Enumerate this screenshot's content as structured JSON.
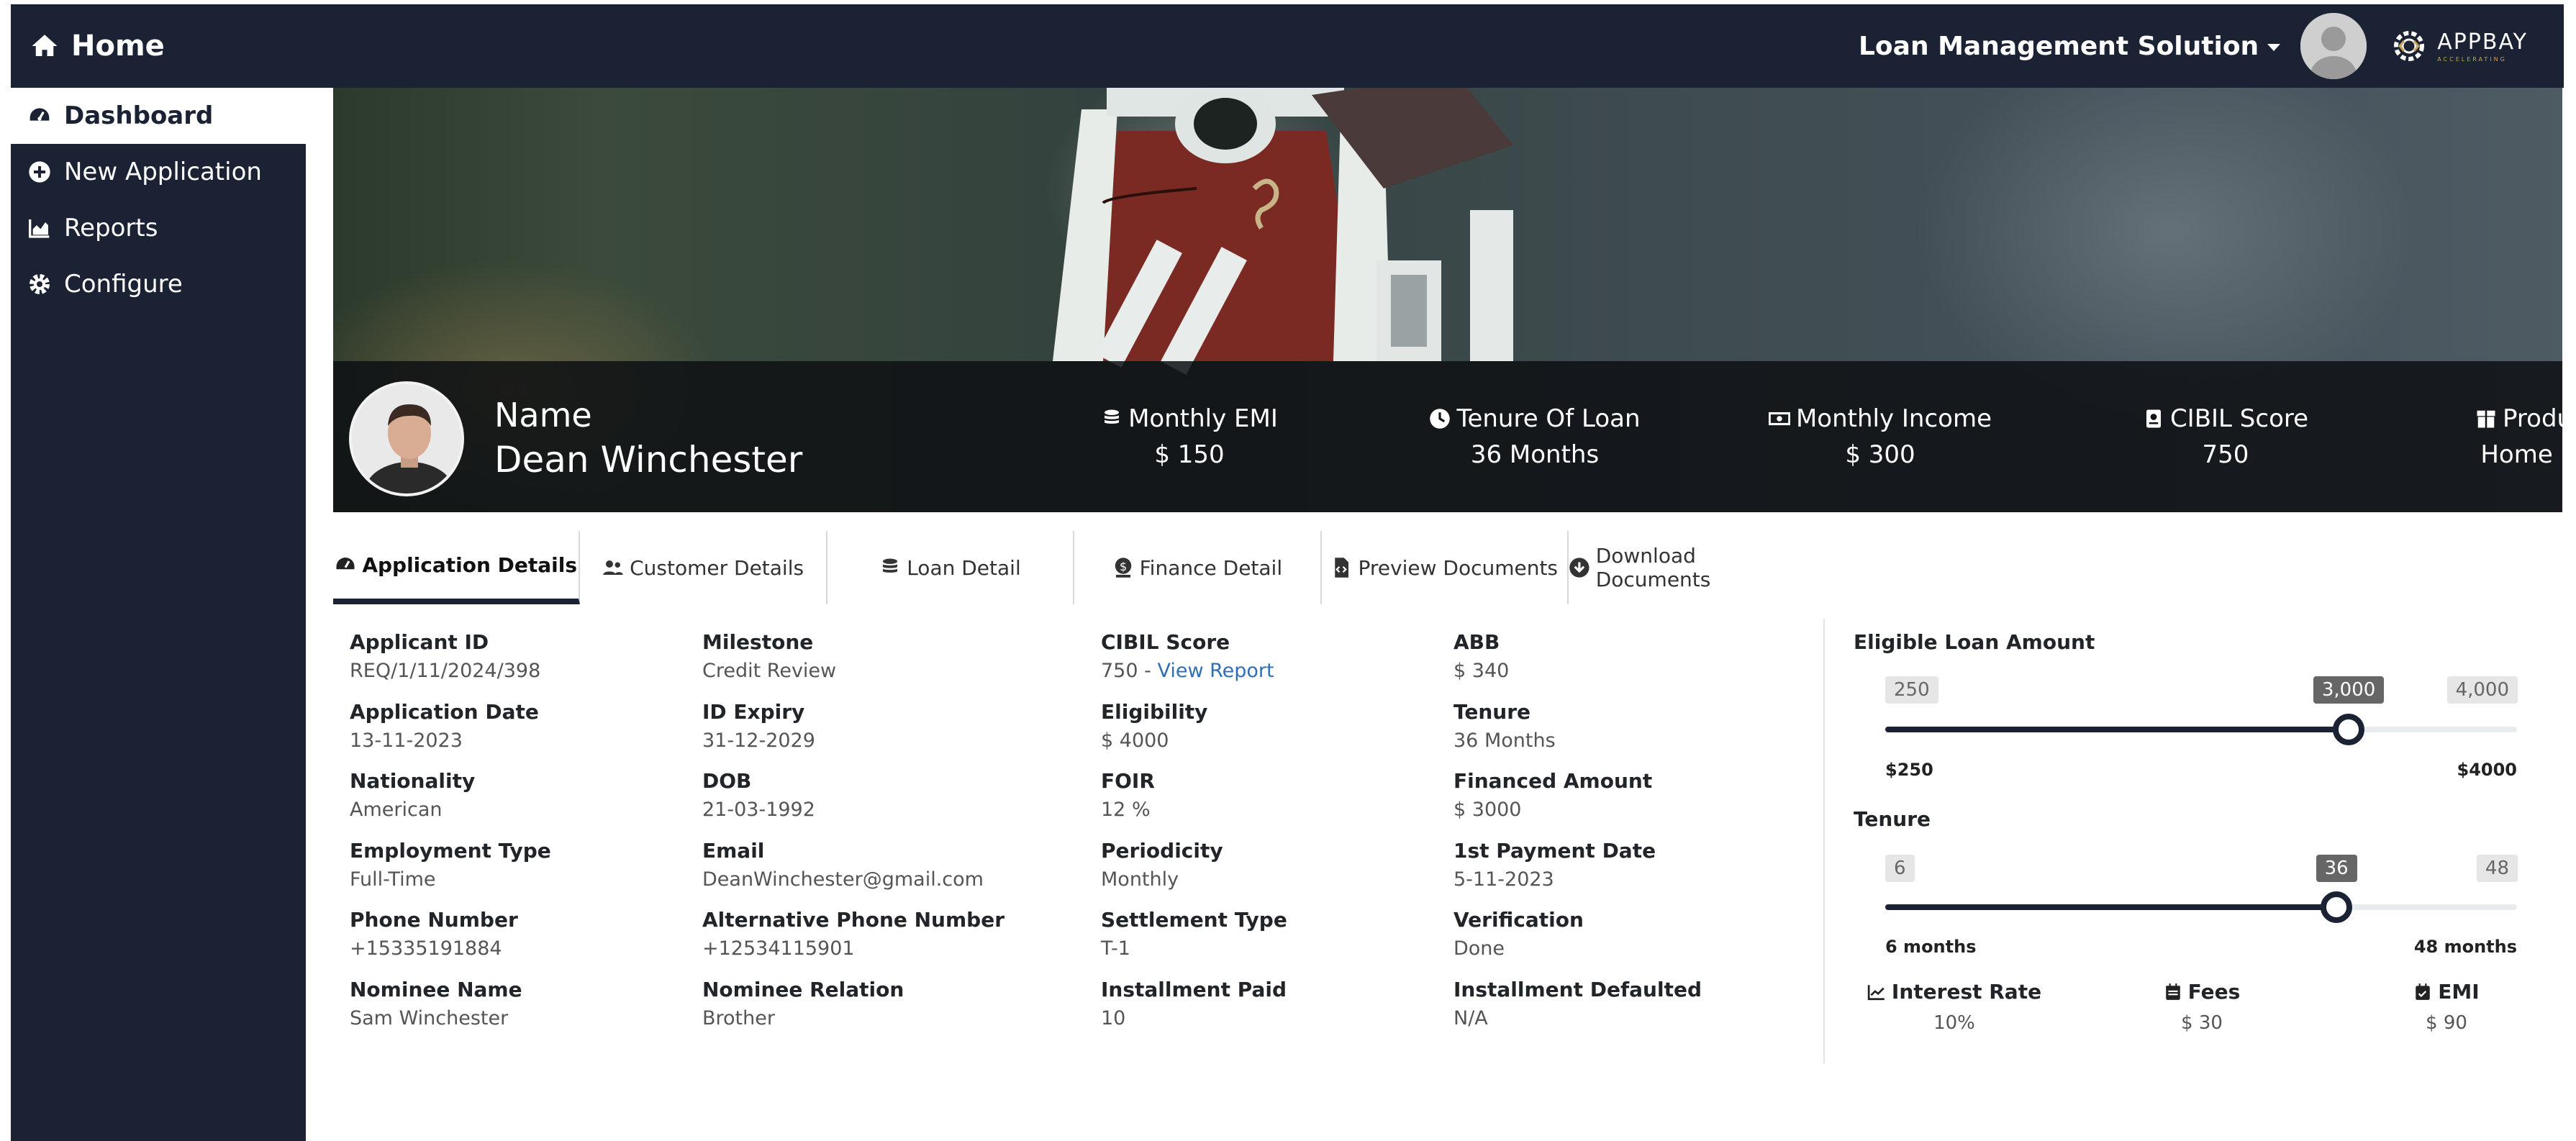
{
  "header": {
    "home_label": "Home",
    "app_selector": "Loan Management Solution",
    "logo_main": "APPBAY",
    "logo_sub": "ACCELERATING"
  },
  "sidebar": {
    "items": [
      {
        "label": "Dashboard",
        "icon": "tachometer-icon",
        "active": true
      },
      {
        "label": "New Application",
        "icon": "plus-circle-icon"
      },
      {
        "label": "Reports",
        "icon": "area-chart-icon"
      },
      {
        "label": "Configure",
        "icon": "gear-icon"
      }
    ]
  },
  "profile": {
    "name_label": "Name",
    "name": "Dean Winchester",
    "stats": [
      {
        "label": "Monthly EMI",
        "value": "$ 150",
        "icon": "coins-icon"
      },
      {
        "label": "Tenure Of Loan",
        "value": "36 Months",
        "icon": "clock-icon"
      },
      {
        "label": "Monthly Income",
        "value": "$ 300",
        "icon": "money-bill-icon"
      },
      {
        "label": "CIBIL Score",
        "value": "750",
        "icon": "id-badge-icon"
      },
      {
        "label": "Product Type",
        "value": "Home Finance",
        "icon": "box-icon"
      }
    ]
  },
  "tabs": [
    {
      "label": "Application Details",
      "icon": "tachometer-icon",
      "active": true
    },
    {
      "label": "Customer Details",
      "icon": "users-icon"
    },
    {
      "label": "Loan Detail",
      "icon": "coins-icon"
    },
    {
      "label": "Finance Detail",
      "icon": "dollar-icon"
    },
    {
      "label": "Preview Documents",
      "icon": "file-code-icon"
    },
    {
      "label": "Download Documents",
      "icon": "download-circle-icon"
    }
  ],
  "details": {
    "col1": [
      {
        "label": "Applicant ID",
        "value": "REQ/1/11/2024/398"
      },
      {
        "label": "Application Date",
        "value": "13-11-2023"
      },
      {
        "label": "Nationality",
        "value": "American"
      },
      {
        "label": "Employment Type",
        "value": "Full-Time"
      },
      {
        "label": "Phone Number",
        "value": "+15335191884"
      },
      {
        "label": "Nominee Name",
        "value": "Sam Winchester"
      }
    ],
    "col2": [
      {
        "label": "Milestone",
        "value": "Credit Review"
      },
      {
        "label": "ID Expiry",
        "value": "31-12-2029"
      },
      {
        "label": "DOB",
        "value": "21-03-1992"
      },
      {
        "label": "Email",
        "value": "DeanWinchester@gmail.com"
      },
      {
        "label": "Alternative Phone Number",
        "value": "+12534115901"
      },
      {
        "label": "Nominee Relation",
        "value": "Brother"
      }
    ],
    "col3": [
      {
        "label": "CIBIL Score",
        "value": "750 - ",
        "link": "View Report"
      },
      {
        "label": "Eligibility",
        "value": "$ 4000"
      },
      {
        "label": "FOIR",
        "value": "12 %"
      },
      {
        "label": "Periodicity",
        "value": "Monthly"
      },
      {
        "label": "Settlement Type",
        "value": "T-1"
      },
      {
        "label": "Installment Paid",
        "value": "10"
      }
    ],
    "col4": [
      {
        "label": "ABB",
        "value": "$ 340"
      },
      {
        "label": "Tenure",
        "value": "36 Months"
      },
      {
        "label": "Financed Amount",
        "value": "$ 3000"
      },
      {
        "label": "1st Payment Date",
        "value": "5-11-2023"
      },
      {
        "label": "Verification",
        "value": "Done"
      },
      {
        "label": "Installment Defaulted",
        "value": "N/A"
      }
    ]
  },
  "loan_slider": {
    "title": "Eligible Loan Amount",
    "min_badge": "250",
    "value_badge": "3,000",
    "max_badge": "4,000",
    "min_label": "$250",
    "max_label": "$4000",
    "min": 250,
    "max": 4000,
    "value": 3000
  },
  "tenure_slider": {
    "title": "Tenure",
    "min_badge": "6",
    "value_badge": "36",
    "max_badge": "48",
    "min_label": "6 months",
    "max_label": "48 months",
    "min": 6,
    "max": 48,
    "value": 36
  },
  "summary": [
    {
      "label": "Interest Rate",
      "value": "10%",
      "icon": "line-chart-icon"
    },
    {
      "label": "Fees",
      "value": "$ 30",
      "icon": "calendar-icon"
    },
    {
      "label": "EMI",
      "value": "$ 90",
      "icon": "calendar-check-icon"
    }
  ],
  "colors": {
    "navy": "#1b2233",
    "link": "#2f6fb6",
    "badge_active": "#666666"
  }
}
